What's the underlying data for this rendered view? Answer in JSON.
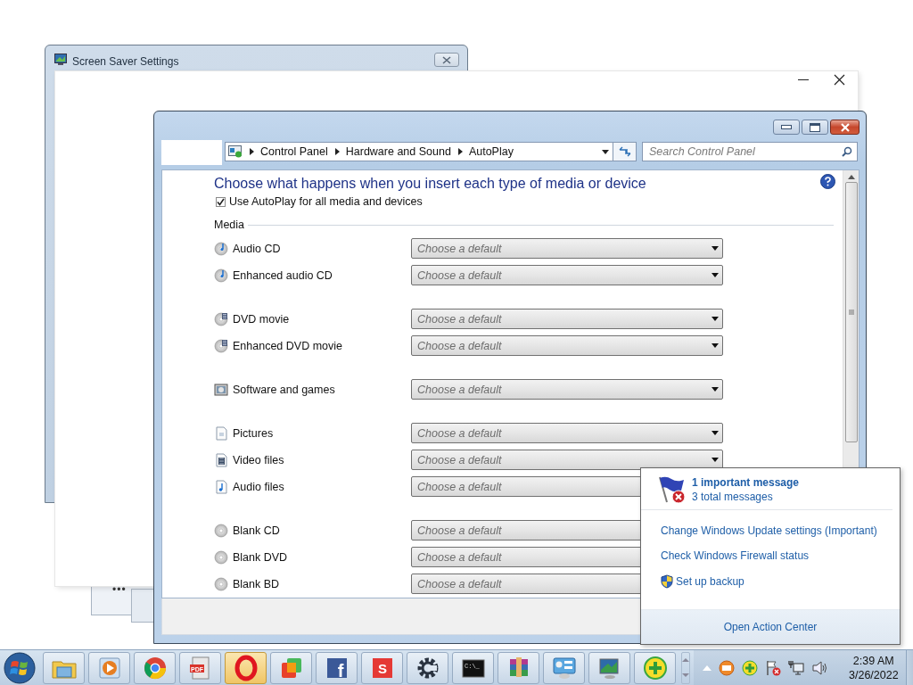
{
  "background_windows": {
    "screen_saver": {
      "title": "Screen Saver Settings"
    },
    "stack_label": "•••"
  },
  "window": {
    "breadcrumb": [
      "Control Panel",
      "Hardware and Sound",
      "AutoPlay"
    ],
    "search": {
      "placeholder": "Search Control Panel"
    },
    "heading": "Choose what happens when you insert each type of media or device",
    "autoplay_checkbox": {
      "label": "Use AutoPlay for all media and devices",
      "checked": true
    },
    "section": "Media",
    "groups": [
      {
        "items": [
          {
            "kind": "audio-cd",
            "label": "Audio CD",
            "value": "Choose a default"
          },
          {
            "kind": "audio-cd",
            "label": "Enhanced audio CD",
            "value": "Choose a default"
          }
        ]
      },
      {
        "items": [
          {
            "kind": "dvd",
            "label": "DVD movie",
            "value": "Choose a default"
          },
          {
            "kind": "dvd",
            "label": "Enhanced DVD movie",
            "value": "Choose a default"
          }
        ]
      },
      {
        "items": [
          {
            "kind": "software",
            "label": "Software and games",
            "value": "Choose a default"
          }
        ]
      },
      {
        "items": [
          {
            "kind": "picture",
            "label": "Pictures",
            "value": "Choose a default"
          },
          {
            "kind": "video",
            "label": "Video files",
            "value": "Choose a default"
          },
          {
            "kind": "audio-file",
            "label": "Audio files",
            "value": "Choose a default"
          }
        ]
      },
      {
        "items": [
          {
            "kind": "blank",
            "label": "Blank CD",
            "value": "Choose a default"
          },
          {
            "kind": "blank",
            "label": "Blank DVD",
            "value": "Choose a default"
          },
          {
            "kind": "blank",
            "label": "Blank BD",
            "value": "Choose a default"
          }
        ]
      }
    ]
  },
  "action_center": {
    "headline": "1 important message",
    "subline": "3 total messages",
    "links": [
      {
        "kind": "plain",
        "label": "Change Windows Update settings (Important)"
      },
      {
        "kind": "plain",
        "label": "Check Windows Firewall status"
      },
      {
        "kind": "shield",
        "label": "Set up backup"
      }
    ],
    "footer": "Open Action Center"
  },
  "taskbar": {
    "items": [
      {
        "kind": "explorer",
        "selected": false
      },
      {
        "kind": "media",
        "selected": false
      },
      {
        "kind": "chrome",
        "selected": false
      },
      {
        "kind": "pdf",
        "glyph": "PDF",
        "selected": false
      },
      {
        "kind": "opera",
        "selected": true
      },
      {
        "kind": "squares",
        "selected": false
      },
      {
        "kind": "facebook",
        "glyph": "f",
        "selected": false
      },
      {
        "kind": "letter",
        "glyph": "S",
        "selected": false
      },
      {
        "kind": "gear",
        "selected": false
      },
      {
        "kind": "terminal",
        "glyph": "C:\\_",
        "selected": false
      },
      {
        "kind": "archive",
        "selected": false
      },
      {
        "kind": "panel",
        "selected": false
      },
      {
        "kind": "monitor",
        "selected": false
      },
      {
        "kind": "plus",
        "selected": false
      }
    ],
    "clock": {
      "time": "2:39 AM",
      "date": "3/26/2022"
    }
  }
}
